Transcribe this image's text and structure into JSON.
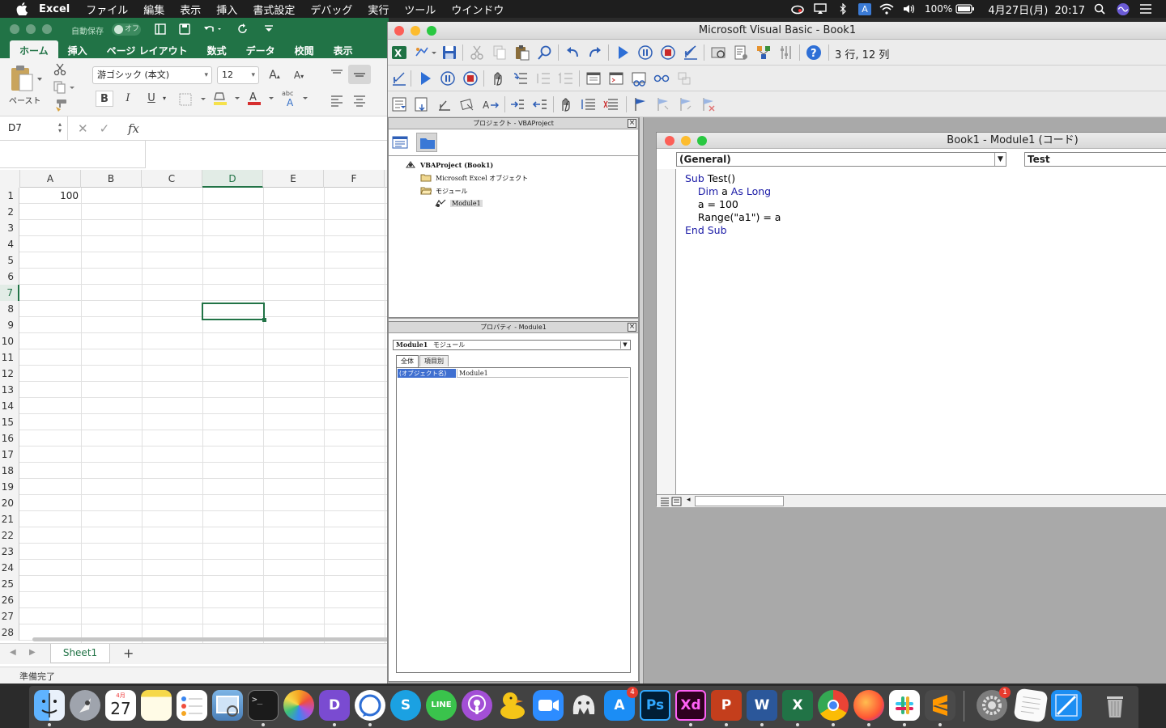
{
  "menubar": {
    "app": "Excel",
    "items": [
      "ファイル",
      "編集",
      "表示",
      "挿入",
      "書式設定",
      "デバッグ",
      "実行",
      "ツール",
      "ウインドウ"
    ],
    "battery": "100%",
    "ime": "A",
    "datetime": "4月27日(月)  20:17"
  },
  "excel": {
    "autosave_label": "自動保存",
    "autosave_state": "オフ",
    "tabs": [
      "ホーム",
      "挿入",
      "ページ レイアウト",
      "数式",
      "データ",
      "校閲",
      "表示"
    ],
    "paste_label": "ペースト",
    "font_name": "游ゴシック (本文)",
    "font_size": "12",
    "name_box": "D7",
    "fx_label": "fx",
    "columns": [
      "A",
      "B",
      "C",
      "D",
      "E",
      "F"
    ],
    "rows": [
      "1",
      "2",
      "3",
      "4",
      "5",
      "6",
      "7",
      "8",
      "9",
      "10",
      "11",
      "12",
      "13",
      "14",
      "15",
      "16",
      "17",
      "18",
      "19",
      "20",
      "21",
      "22",
      "23",
      "24",
      "25",
      "26",
      "27",
      "28"
    ],
    "cell_a1": "100",
    "sheet_tab": "Sheet1",
    "add_sheet": "+",
    "status": "準備完了"
  },
  "vbe": {
    "title": "Microsoft Visual Basic - Book1",
    "caret_position": "3 行, 12 列",
    "project_pane": {
      "title": "プロジェクト - VBAProject",
      "tree": {
        "root": "VBAProject (Book1)",
        "objects": "Microsoft Excel オブジェクト",
        "modules": "モジュール",
        "module": "Module1"
      }
    },
    "properties_pane": {
      "title": "プロパティ - Module1",
      "object_name": "Module1",
      "object_type": "モジュール",
      "tabs": [
        "全体",
        "項目別"
      ],
      "prop_name": "(オブジェクト名)",
      "prop_value": "Module1"
    },
    "code_window": {
      "title": "Book1 - Module1 (コード)",
      "object_combo": "(General)",
      "proc_combo": "Test",
      "lines": [
        {
          "indent": "",
          "kw": "Sub ",
          "text": "Test()"
        },
        {
          "indent": "    ",
          "kw": "Dim ",
          "text": "a ",
          "kw2": "As Long"
        },
        {
          "indent": "    ",
          "kw": "",
          "text": "a = 100"
        },
        {
          "indent": "    ",
          "kw": "",
          "text": "Range(\"a1\") = a"
        },
        {
          "indent": "",
          "kw": "End Sub",
          "text": ""
        }
      ]
    }
  },
  "dock": {
    "calendar_day": "27",
    "calendar_month": "4月",
    "appstore_badge": "4",
    "prefs_badge": "1",
    "apps": [
      "finder-icon",
      "launchpad-icon",
      "calendar-icon",
      "notes-icon",
      "reminders-icon",
      "preview-icon",
      "terminal-icon",
      "photos-icon",
      "dash-icon",
      "signal-icon",
      "skype-icon",
      "line-icon",
      "podcasts-icon",
      "cyberduck-icon",
      "zoom-icon",
      "tableplus-icon",
      "appstore-icon",
      "photoshop-icon",
      "xd-icon",
      "powerpoint-icon",
      "word-icon",
      "excel-icon",
      "chrome-icon",
      "firefox-icon",
      "slack-icon",
      "sublime-icon",
      "system-prefs-icon",
      "textedit-icon",
      "xcode-icon",
      "trash-icon"
    ],
    "photoshop_label": "Ps",
    "xd_label": "Xd",
    "powerpoint_label": "P",
    "word_label": "W",
    "excel_label": "X"
  },
  "colors": {
    "excel_green": "#217346",
    "vba_keyword": "#1a1aa6"
  }
}
